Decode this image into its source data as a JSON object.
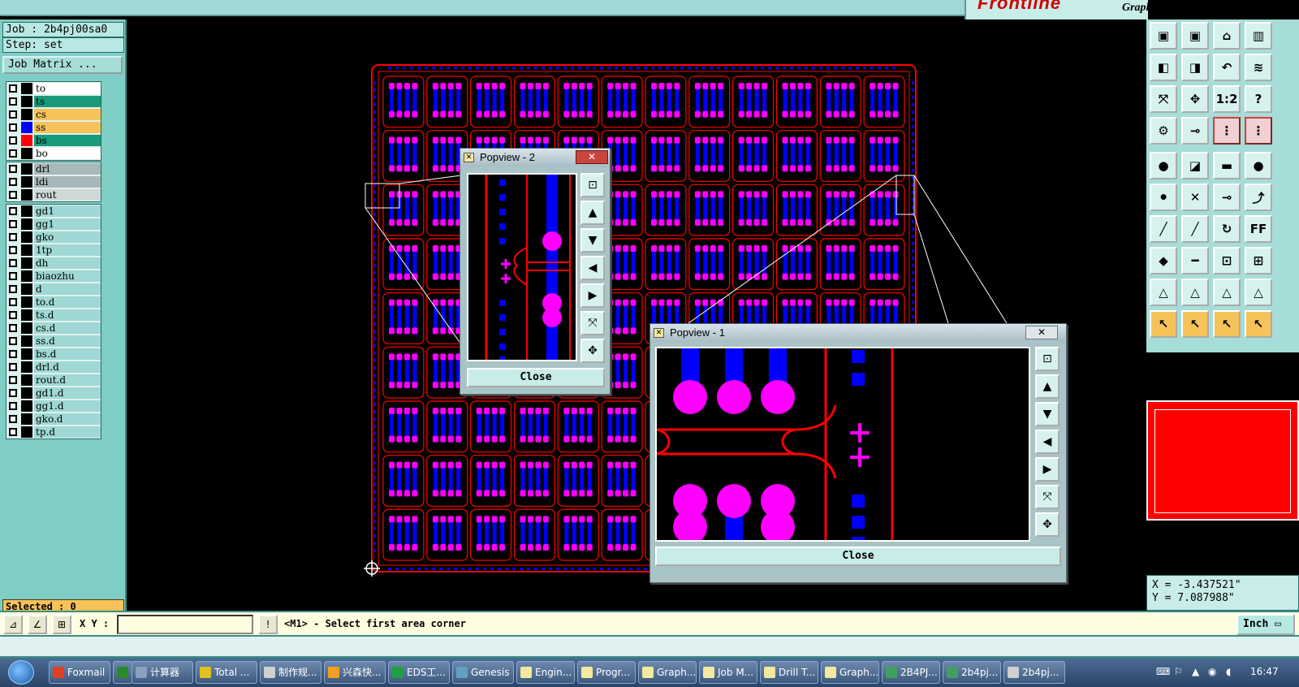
{
  "titlebar": {
    "text": "Frontline  Graphic Editor"
  },
  "brand": {
    "logo": "Frontline",
    "subtitle": "Graphic Editor"
  },
  "job": {
    "name": "Job : 2b4pj00sa0",
    "step": "Step: set",
    "matrix_button": "Job Matrix ..."
  },
  "layers_group1": [
    {
      "name": "to",
      "bg": "#ffffff",
      "swatch": ""
    },
    {
      "name": "ts",
      "bg": "#1a9a7a",
      "swatch": ""
    },
    {
      "name": "cs",
      "bg": "#f6c25a",
      "swatch": ""
    },
    {
      "name": "ss",
      "bg": "#f6c25a",
      "swatch": "#0000ff"
    },
    {
      "name": "bs",
      "bg": "#1a9a7a",
      "swatch": "#ff0000"
    },
    {
      "name": "bo",
      "bg": "#ffffff",
      "swatch": ""
    }
  ],
  "layers_group2": [
    {
      "name": "drl",
      "bg": "#a8b8ba"
    },
    {
      "name": "ldi",
      "bg": "#a8b8ba"
    },
    {
      "name": "rout",
      "bg": "#d0d8d8"
    }
  ],
  "layers_group3": [
    {
      "name": "gd1"
    },
    {
      "name": "gg1"
    },
    {
      "name": "gko"
    },
    {
      "name": "1tp"
    },
    {
      "name": "dh"
    },
    {
      "name": "biaozhu"
    },
    {
      "name": "d"
    },
    {
      "name": "to.d"
    },
    {
      "name": "ts.d"
    },
    {
      "name": "cs.d"
    },
    {
      "name": "ss.d"
    },
    {
      "name": "bs.d"
    },
    {
      "name": "drl.d"
    },
    {
      "name": "rout.d"
    },
    {
      "name": "gd1.d"
    },
    {
      "name": "gg1.d"
    },
    {
      "name": "gko.d"
    },
    {
      "name": "tp.d"
    }
  ],
  "selected": "Selected : 0",
  "popview2": {
    "title": "Popview - 2",
    "close": "Close"
  },
  "popview1": {
    "title": "Popview - 1",
    "close": "Close"
  },
  "coords": {
    "x": "X = -3.437521\"",
    "y": "Y = 7.087988\""
  },
  "cmdbar": {
    "xy_label": "X Y :",
    "xy_value": "",
    "prompt": "<M1> - Select first area corner",
    "unit": "Inch"
  },
  "taskbar": {
    "tasks": [
      {
        "label": "Foxmail",
        "color": "#e04020"
      },
      {
        "label": "",
        "color": "#2a8a2a"
      },
      {
        "label": "计算器",
        "color": "#8aa0c0"
      },
      {
        "label": "Total ...",
        "color": "#e0c020"
      },
      {
        "label": "制作规...",
        "color": "#d0d0d0"
      },
      {
        "label": "兴森快...",
        "color": "#f0a020"
      },
      {
        "label": "EDS工...",
        "color": "#20a040"
      },
      {
        "label": "Genesis",
        "color": "#60a0c0"
      },
      {
        "label": "Engin...",
        "color": "#f4e8a0"
      },
      {
        "label": "Progr...",
        "color": "#f4e8a0"
      },
      {
        "label": "Graph...",
        "color": "#f4e8a0"
      },
      {
        "label": "Job M...",
        "color": "#f4e8a0"
      },
      {
        "label": "Drill T...",
        "color": "#f4e8a0"
      },
      {
        "label": "Graph...",
        "color": "#f4e8a0"
      },
      {
        "label": "2B4PJ...",
        "color": "#40a060"
      },
      {
        "label": "2b4pj...",
        "color": "#40a060"
      },
      {
        "label": "2b4pj...",
        "color": "#d0d0d0"
      }
    ],
    "clock": "16:47"
  },
  "colors": {
    "pad": "#ff00ff",
    "trace": "#0000ff",
    "outline": "#ff0000",
    "panel": "#7fcec6"
  },
  "toolbar_icons": [
    "move-up-icon",
    "move-down-icon",
    "home-icon",
    "split-icon",
    "move-left-icon",
    "move-right-icon",
    "undo-icon",
    "redraw-icon",
    "fit-icon",
    "zoom-icon",
    "scale-icon",
    "help-icon",
    "tool-icon",
    "probe-icon",
    "net-icon",
    "net2-icon",
    "circle-icon",
    "select-red-icon",
    "ruler-icon",
    "dot-icon",
    "node-icon",
    "cross-icon",
    "add-node-icon",
    "extend-icon",
    "line-icon",
    "line2-icon",
    "arc-icon",
    "font-icon",
    "pad-icon",
    "dash-icon",
    "measure-icon",
    "group-icon",
    "triangle-icon",
    "triangle2-icon",
    "triangle3-icon",
    "triangle4-icon",
    "pointer-icon",
    "pointer2-icon",
    "pointer3-icon",
    "pointer4-icon"
  ]
}
